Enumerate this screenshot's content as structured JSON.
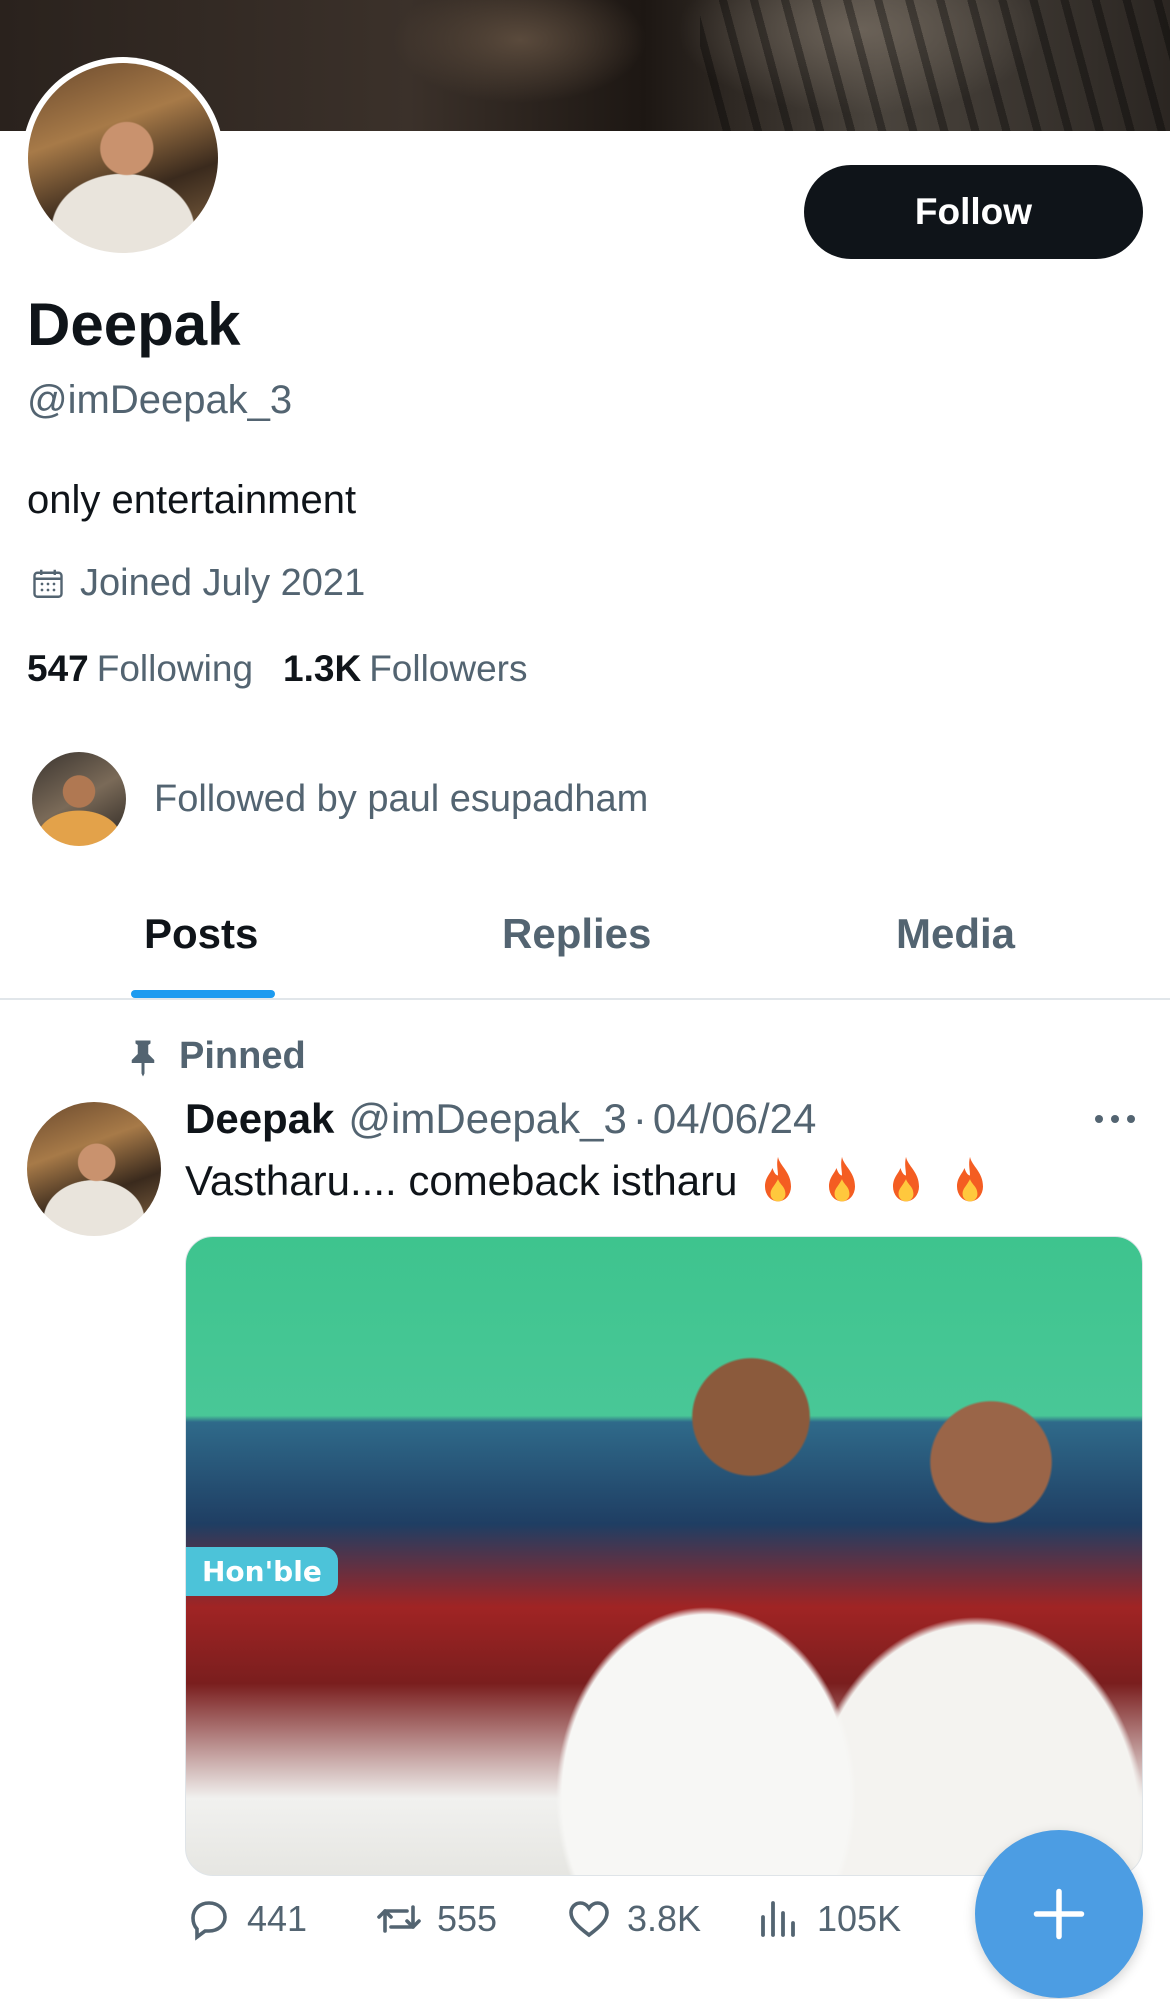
{
  "profile": {
    "name": "Deepak",
    "handle": "@imDeepak_3",
    "bio": "only entertainment",
    "joined": "Joined July 2021",
    "follow_label": "Follow",
    "following_count": "547",
    "following_label": "Following",
    "followers_count": "1.3K",
    "followers_label": "Followers",
    "followed_by": "Followed by paul esupadham"
  },
  "tabs": [
    {
      "label": "Posts",
      "active": true
    },
    {
      "label": "Replies",
      "active": false
    },
    {
      "label": "Media",
      "active": false
    }
  ],
  "post": {
    "pinned_label": "Pinned",
    "author_name": "Deepak",
    "author_handle": "@imDeepak_3",
    "separator": "·",
    "date": "04/06/24",
    "text": "Vastharu.... comeback istharu",
    "emoji_count": 4,
    "image_sign_text": "Hon'ble",
    "replies": "441",
    "reposts": "555",
    "likes": "3.8K",
    "views": "105K"
  },
  "icons": {
    "calendar": "calendar-icon",
    "pin": "pin-icon",
    "more": "more-icon",
    "reply": "reply-icon",
    "repost": "repost-icon",
    "like": "heart-icon",
    "views": "views-icon",
    "compose": "plus-icon"
  },
  "colors": {
    "accent": "#1d9bf0",
    "fab": "#4c9de3",
    "text_primary": "#0f1419",
    "text_secondary": "#536471"
  }
}
